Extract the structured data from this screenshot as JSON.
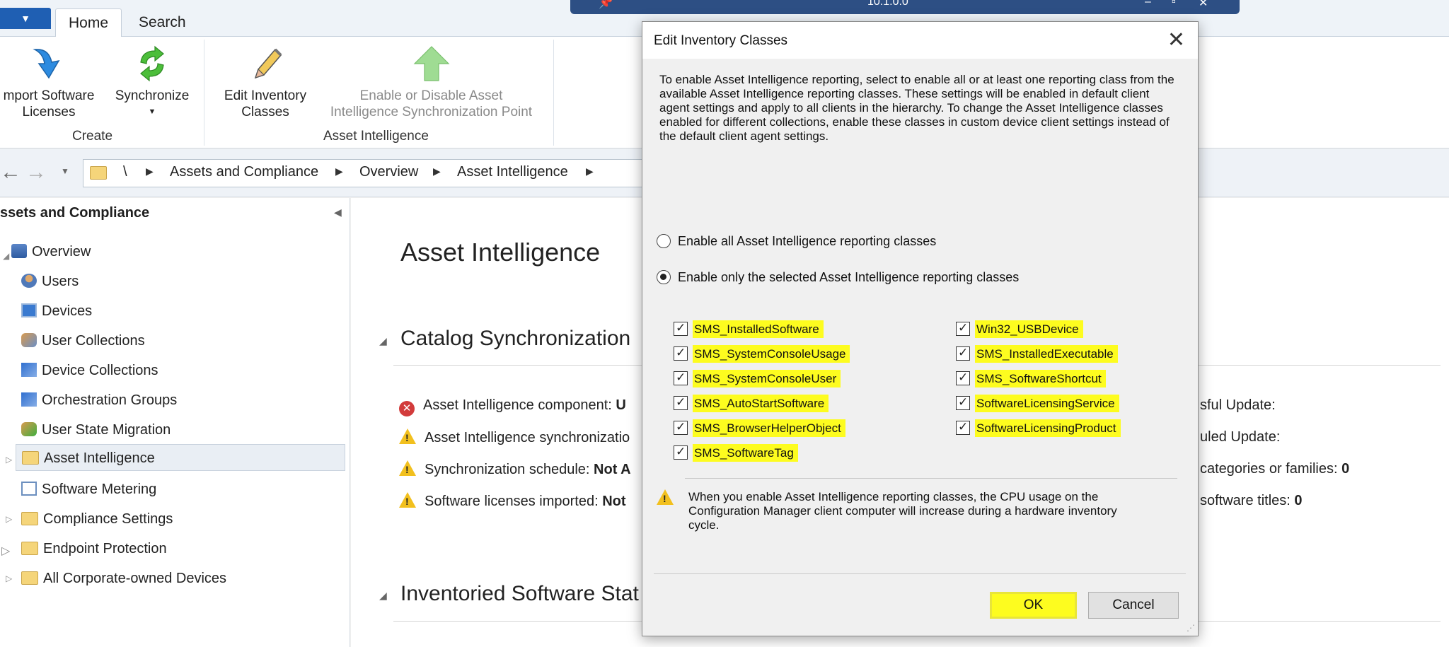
{
  "ribbon": {
    "tabs": [
      {
        "label": "Home"
      },
      {
        "label": "Search"
      }
    ],
    "buttons": {
      "import_licenses": "mport Software\nLicenses",
      "synchronize": "Synchronize",
      "edit_inventory": "Edit Inventory\nClasses",
      "enable_disable": "Enable or Disable Asset\nIntelligence Synchronization Point"
    },
    "groups": {
      "create": "Create",
      "asset_intelligence": "Asset Intelligence"
    }
  },
  "breadcrumb": {
    "root": "\\",
    "items": [
      "Assets and Compliance",
      "Overview",
      "Asset Intelligence"
    ]
  },
  "leftnav": {
    "header": "ssets and Compliance",
    "items": [
      {
        "label": "Overview"
      },
      {
        "label": "Users"
      },
      {
        "label": "Devices"
      },
      {
        "label": "User Collections"
      },
      {
        "label": "Device Collections"
      },
      {
        "label": "Orchestration Groups"
      },
      {
        "label": "User State Migration"
      },
      {
        "label": "Asset Intelligence"
      },
      {
        "label": "Software Metering"
      },
      {
        "label": "Compliance Settings"
      },
      {
        "label": "Endpoint Protection"
      },
      {
        "label": "All Corporate-owned Devices"
      }
    ]
  },
  "main": {
    "title": "Asset Intelligence",
    "section1": "Catalog Synchronization",
    "section2": "Inventoried Software Stat",
    "rows": [
      {
        "label": "Asset Intelligence component: ",
        "value": "U"
      },
      {
        "label": "Asset Intelligence synchronizatio",
        "value": ""
      },
      {
        "label": "Synchronization schedule: ",
        "value": "Not A"
      },
      {
        "label": "Software licenses imported: ",
        "value": "Not"
      }
    ],
    "right": [
      {
        "label": "sful Update:",
        "value": ""
      },
      {
        "label": "uled Update:",
        "value": ""
      },
      {
        "label": "categories or families: ",
        "value": "0"
      },
      {
        "label": "software titles: ",
        "value": "0"
      }
    ]
  },
  "remote_bar": {
    "title": "10.1.0.0"
  },
  "dialog": {
    "title": "Edit Inventory Classes",
    "description": "To enable Asset Intelligence reporting, select to enable all or at least one reporting class from the available Asset Intelligence reporting classes. These settings will be enabled in default client agent settings and apply to all clients in the hierarchy. To change the Asset Intelligence classes enabled for different collections, enable these classes in custom device client settings instead of the default client agent settings.",
    "radio_all": "Enable all Asset Intelligence reporting classes",
    "radio_selected": "Enable only the selected Asset Intelligence reporting classes",
    "classes_left": [
      "SMS_InstalledSoftware",
      "SMS_SystemConsoleUsage",
      "SMS_SystemConsoleUser",
      "SMS_AutoStartSoftware",
      "SMS_BrowserHelperObject",
      "SMS_SoftwareTag"
    ],
    "classes_right": [
      "Win32_USBDevice",
      "SMS_InstalledExecutable",
      "SMS_SoftwareShortcut",
      "SoftwareLicensingService",
      "SoftwareLicensingProduct"
    ],
    "warning": "When you enable Asset Intelligence reporting classes, the CPU usage on the Configuration Manager client computer will increase during a hardware inventory cycle.",
    "ok_label": "OK",
    "cancel_label": "Cancel"
  },
  "colors": {
    "highlight": "#fdfc1f",
    "accent": "#1f5fb3"
  }
}
